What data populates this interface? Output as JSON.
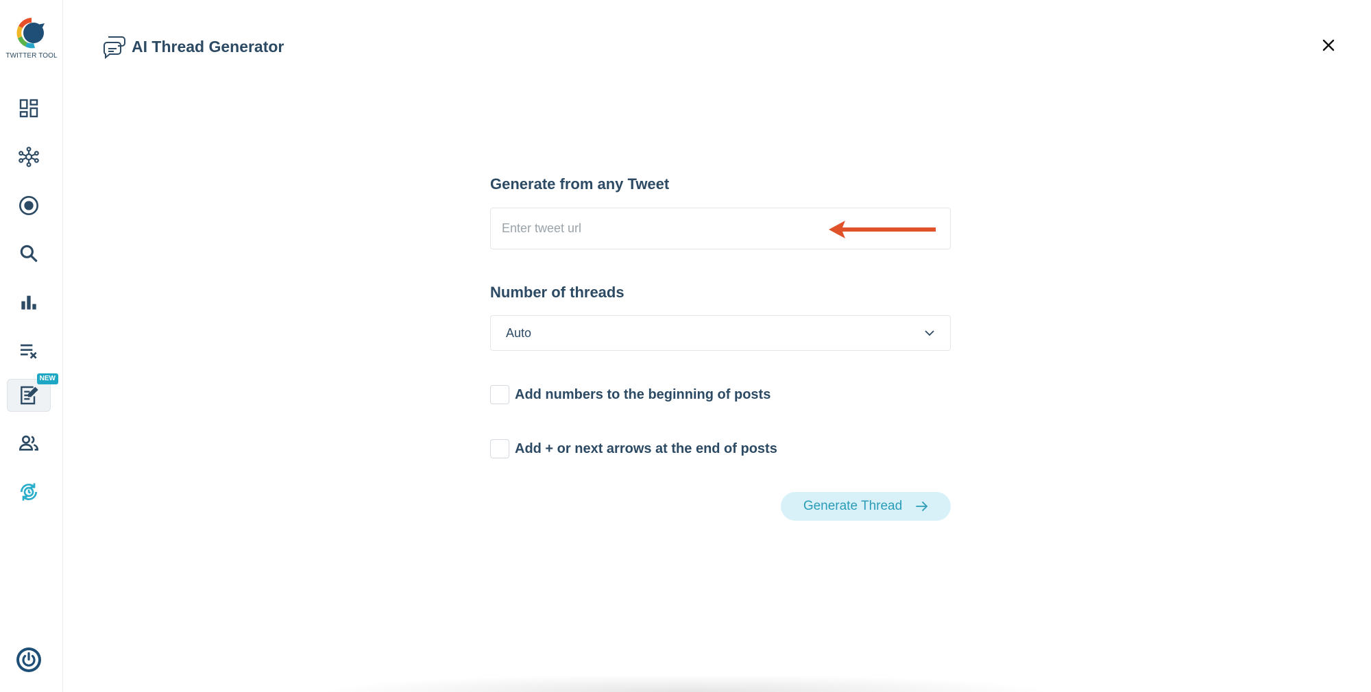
{
  "app": {
    "logo_text": "TWITTER TOOL"
  },
  "sidebar": {
    "items": [
      {
        "icon": "dashboard-icon"
      },
      {
        "icon": "network-icon"
      },
      {
        "icon": "target-icon"
      },
      {
        "icon": "search-icon"
      },
      {
        "icon": "bar-chart-icon"
      },
      {
        "icon": "clear-list-icon"
      },
      {
        "icon": "edit-note-icon",
        "badge": "NEW",
        "active": true
      },
      {
        "icon": "users-icon"
      },
      {
        "icon": "clock-refresh-icon"
      }
    ],
    "power_icon": "power-icon"
  },
  "header": {
    "title": "AI Thread Generator"
  },
  "form": {
    "tweet_label": "Generate from any Tweet",
    "tweet_placeholder": "Enter tweet url",
    "threads_label": "Number of threads",
    "threads_value": "Auto",
    "option_numbers": "Add numbers to the beginning of posts",
    "option_arrows": "Add + or next arrows at the end of posts",
    "generate_button": "Generate Thread"
  },
  "colors": {
    "primary_text": "#2c4a63",
    "accent": "#2a9cb8",
    "button_bg": "#d8f1f8",
    "annotation_arrow": "#e0532a",
    "badge": "#1ea7c5"
  }
}
